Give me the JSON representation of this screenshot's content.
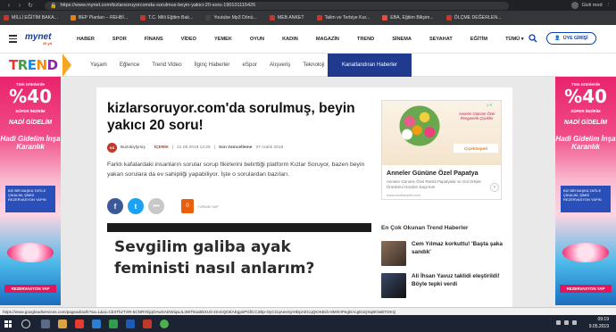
{
  "browser": {
    "url": "https://www.mynet.com/kizlarsoruyorcomda-sorulmus-beyin-yakici-20-soru-190101115426",
    "profile_name": "Gizli mod",
    "bookmarks": [
      {
        "label": "MİLLİ EĞİTİM BAKA...",
        "color": "#c0392b"
      },
      {
        "label": "BEP Planları – REHBİ...",
        "color": "#e67e22"
      },
      {
        "label": "T.C. Milli Eğitim Bak...",
        "color": "#c0392b"
      },
      {
        "label": "Youtube Mp3 Dönü...",
        "color": "#444"
      },
      {
        "label": "MEB ANKET",
        "color": "#c0392b"
      },
      {
        "label": "Talim ve Terbiye Kur...",
        "color": "#c0392b"
      },
      {
        "label": "EBA, Eğitim Bilişim...",
        "color": "#e74c3c"
      },
      {
        "label": "ÖLÇME DEĞERLEN...",
        "color": "#c0392b"
      }
    ]
  },
  "site": {
    "logo": "mynet",
    "logo_sub": "20 yıl",
    "nav": [
      "HABER",
      "SPOR",
      "FİNANS",
      "VİDEO",
      "YEMEK",
      "OYUN",
      "KADIN",
      "MAGAZİN",
      "TREND",
      "SİNEMA",
      "SEYAHAT",
      "EĞİTİM",
      "TÜMÜ ▾"
    ],
    "login": "ÜYE GİRİŞİ"
  },
  "trend": {
    "logo": "TREND",
    "nav": [
      "Yaşam",
      "Eğlence",
      "Trend Video",
      "İlginç Haberler",
      "eSpor",
      "Alışveriş",
      "Teknoloji"
    ],
    "special": "Kanatlandıran Haberler"
  },
  "side_ad": {
    "top": "Tüm ürünlerde",
    "percent": "%40",
    "sub": "SÜPER İNDİRİM",
    "headline": "NADİ GİDELİM",
    "promo": "Hadi Gidelim İnşa Karanlık",
    "blue_box": "BİZ BİR BAŞKA TATİLE ÇIKALIM, ŞİMDİ REZERVASYON YAPIN",
    "cta": "REZERVASYON YAP"
  },
  "article": {
    "headline": "kizlarsoruyor.com'da sorulmuş, beyin yakıcı 20 soru!",
    "author": "Buzokiylymiş",
    "category": "İÇERİK",
    "published": "21.05.2018 14:20",
    "updated_label": "Son Güncelleme",
    "updated": "27 Aralık 2018",
    "summary": "Farklı kafalardaki insanların sorular sorup fikirlerini belirttiği platform Kızlar Soruyor, bazen beyin yakan sorulara da ev sahipliği yapabiliyor. İşte o sorulardan bazıları.",
    "comment_count": "0",
    "comment_label": "YORUM YAP",
    "image_text_1": "Sevgilim galiba ayak",
    "image_text_2": "feministi nasıl anlarım?"
  },
  "right_ad": {
    "tagline": "Anneler Gününe Özel Rengarenk Çiçekler",
    "brand": "ÇiçekSepeti",
    "title": "Anneler Gününe Özel Papatya",
    "desc": "Anneler Gününe Özel Renkli Papatyalar ve Gül Orkide Ürünlerini Gözden Kaçırma!",
    "domain": "www.ciceksepeti.com"
  },
  "trend_news": {
    "title": "En Çok Okunan Trend Haberler",
    "items": [
      {
        "text": "Cem Yılmaz korkuttu! 'Başta şaka sandık'"
      },
      {
        "text": "Ali İhsan Yavuz taklidi eleştirildi! Böyle tepki verdi"
      }
    ]
  },
  "status_url": "https://www.googleadservices.com/pagead/aclk?sa=L&ai=CbXTbzTXR-5CNRYEjqOAwSADWiqwJL3WT8xuBkXU0-2mmQOEAEgpsPGfiCC2Bp-OyCGqAeeSyIHDpAECqQKIKBcb-8MrtHPegDAcgDoQSqBOwBTOKQ",
  "clock": {
    "time": "09:19",
    "date": "9.05.2019"
  }
}
